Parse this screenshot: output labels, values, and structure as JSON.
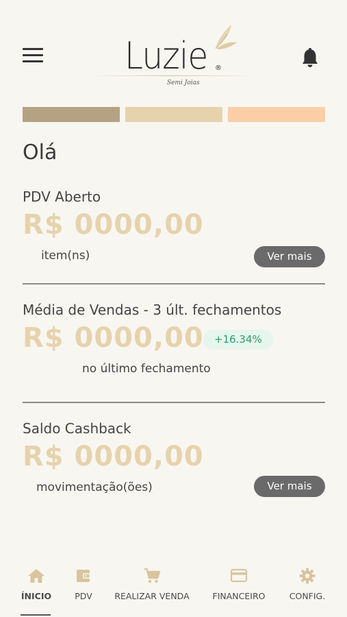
{
  "header": {
    "brand": "Luzie",
    "brand_mark": "®",
    "brand_subtitle": "Semi Joias",
    "menu_icon": "hamburger-menu-icon",
    "bell_icon": "bell-icon"
  },
  "colors": {
    "bar1": "#b5a283",
    "bar2": "#e6d3ad",
    "bar3": "#fbcea6",
    "amount": "#e6d3ad",
    "accent_icon": "#d8c49d",
    "badge_text": "#2e9e63"
  },
  "greeting": "Olá",
  "pdv": {
    "title": "PDV Aberto",
    "amount": "R$ 0000,00",
    "items_label": "item(ns)",
    "button": "Ver mais"
  },
  "sales": {
    "title": "Média de Vendas - 3 últ. fechamentos",
    "amount": "R$ 0000,00",
    "badge": "+16.34%",
    "note": "no último fechamento"
  },
  "cashback": {
    "title": "Saldo Cashback",
    "amount": "R$ 0000,00",
    "movements_label": "movimentação(ões)",
    "button": "Ver mais"
  },
  "nav": {
    "items": [
      {
        "label": "ÍNICIO",
        "icon": "home-icon",
        "active": true
      },
      {
        "label": "PDV",
        "icon": "wallet-icon",
        "active": false
      },
      {
        "label": "REALIZAR VENDA",
        "icon": "cart-icon",
        "active": false
      },
      {
        "label": "FINANCEIRO",
        "icon": "credit-card-icon",
        "active": false
      },
      {
        "label": "CONFIG.",
        "icon": "gear-icon",
        "active": false
      }
    ]
  }
}
